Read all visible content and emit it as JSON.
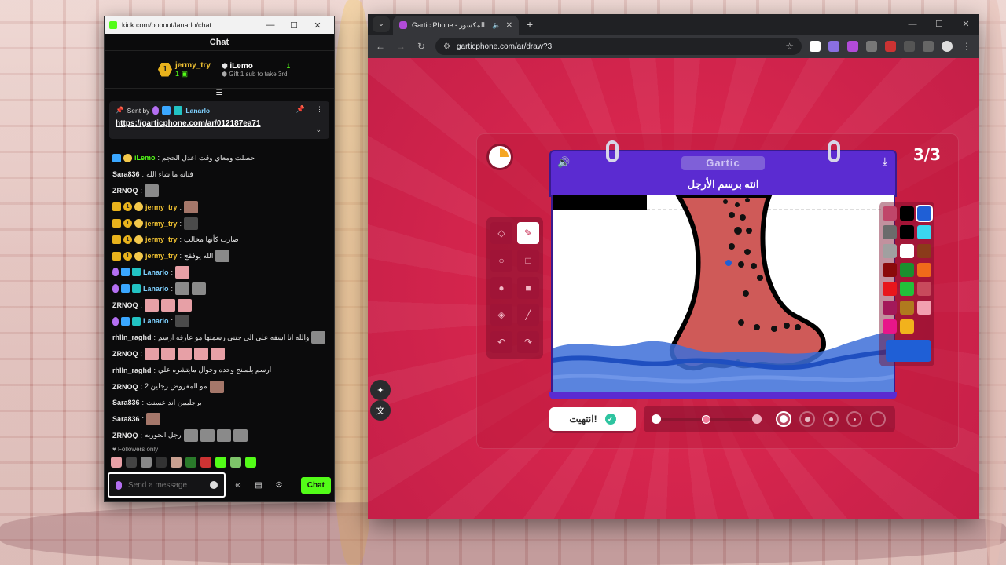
{
  "chat_window": {
    "url": "kick.com/popout/lanarlo/chat",
    "header": "Chat",
    "gift": {
      "left_rank": "1",
      "left_user": "jermy_try",
      "left_count": "1",
      "right_user": "iLemo",
      "right_count": "1",
      "cta": "Gift 1 sub to take 3rd"
    },
    "pinned": {
      "sent_by_label": "Sent by",
      "sender": "Lanarlo",
      "link": "https://garticphone.com/ar/012187ea71"
    },
    "messages": [
      {
        "user": "iLemo",
        "color": "#53fc18",
        "badges": [
          "blue",
          "gold2"
        ],
        "text": "حصلت ومعاي وقت اعدل الحجم",
        "emotes": []
      },
      {
        "user": "Sara836",
        "color": "#e6e6e6",
        "badges": [],
        "text": "فنانه ما شاء الله",
        "emotes": []
      },
      {
        "user": "ZRNOQ",
        "color": "#e6e6e6",
        "badges": [],
        "text": "",
        "emotes": [
          "gray"
        ]
      },
      {
        "user": "jermy_try",
        "color": "#f1c232",
        "badges": [
          "crown",
          "sub",
          "gold2"
        ],
        "text": "",
        "emotes": [
          "brown"
        ]
      },
      {
        "user": "jermy_try",
        "color": "#f1c232",
        "badges": [
          "crown",
          "sub",
          "gold2"
        ],
        "text": "",
        "emotes": [
          "dark"
        ]
      },
      {
        "user": "jermy_try",
        "color": "#f1c232",
        "badges": [
          "crown",
          "sub",
          "gold2"
        ],
        "text": "صارت كأنها مخالب",
        "emotes": []
      },
      {
        "user": "jermy_try",
        "color": "#f1c232",
        "badges": [
          "crown",
          "sub",
          "gold2"
        ],
        "text": "الله يوفقج",
        "emotes": [
          "gray"
        ]
      },
      {
        "user": "Lanarlo",
        "color": "#7fd1ff",
        "badges": [
          "mic",
          "blue",
          "teal"
        ],
        "text": "",
        "emotes": [
          "pink"
        ]
      },
      {
        "user": "Lanarlo",
        "color": "#7fd1ff",
        "badges": [
          "mic",
          "blue",
          "teal"
        ],
        "text": "",
        "emotes": [
          "gray",
          "gray"
        ]
      },
      {
        "user": "ZRNOQ",
        "color": "#e6e6e6",
        "badges": [],
        "text": "",
        "emotes": [
          "pink",
          "pink",
          "pink"
        ]
      },
      {
        "user": "Lanarlo",
        "color": "#7fd1ff",
        "badges": [
          "mic",
          "blue",
          "teal"
        ],
        "text": "",
        "emotes": [
          "dark"
        ]
      },
      {
        "user": "rhlln_raghd",
        "color": "#e6e6e6",
        "badges": [],
        "text": "والله انا اسفه على الي جتني رسمتها مو عارفه ارسم",
        "emotes": [
          "gray"
        ]
      },
      {
        "user": "ZRNOQ",
        "color": "#e6e6e6",
        "badges": [],
        "text": "",
        "emotes": [
          "pink",
          "pink",
          "pink",
          "pink",
          "pink"
        ]
      },
      {
        "user": "rhlln_raghd",
        "color": "#e6e6e6",
        "badges": [],
        "text": "ارسم بلسنج وحده وجوال مايتشره علي",
        "emotes": []
      },
      {
        "user": "ZRNOQ",
        "color": "#e6e6e6",
        "badges": [],
        "text": "مو المفروض رجلين 2",
        "emotes": [
          "brown"
        ]
      },
      {
        "user": "Sara836",
        "color": "#e6e6e6",
        "badges": [],
        "text": "برجلييين اند عسنت",
        "emotes": []
      },
      {
        "user": "Sara836",
        "color": "#e6e6e6",
        "badges": [],
        "text": "",
        "emotes": [
          "brown"
        ]
      },
      {
        "user": "ZRNOQ",
        "color": "#e6e6e6",
        "badges": [],
        "text": "رجل الحوريه",
        "emotes": [
          "gray",
          "gray",
          "gray",
          "gray"
        ]
      },
      {
        "user": "Lanarlo",
        "color": "#7fd1ff",
        "badges": [
          "mic",
          "blue",
          "teal"
        ],
        "text": "",
        "emotes": [
          "pink"
        ]
      }
    ],
    "followers_only": "Followers only",
    "input_placeholder": "Send a message",
    "chat_button": "Chat"
  },
  "browser": {
    "tab_title": "Gartic Phone - الهاتف المكسور",
    "url": "garticphone.com/ar/draw?3"
  },
  "game": {
    "round": "3/3",
    "logo": "Gartic",
    "instruction": "انته برسم الأرجل",
    "done_button": "انتهيت!",
    "timer_elapsed_fraction": 0.25,
    "colors": {
      "swatches": [
        "#c0466a",
        "#000000",
        "#1f5fd6",
        "#6b6b6b",
        "#000000",
        "#3ad7f0",
        "#a0a0a0",
        "#ffffff",
        "#8b3b1a",
        "#8b0a0a",
        "#1a8f2e",
        "#f06a1a",
        "#e8161c",
        "#22c03a",
        "#c84a5c",
        "#a3195a",
        "#b07a1e",
        "#f2a0b0",
        "#e8168a",
        "#f2b21c"
      ],
      "selected_index": 2,
      "current": "#1f5fd6"
    },
    "stroke_slider_value": 0.5,
    "stroke_size_selected_index": 0
  }
}
